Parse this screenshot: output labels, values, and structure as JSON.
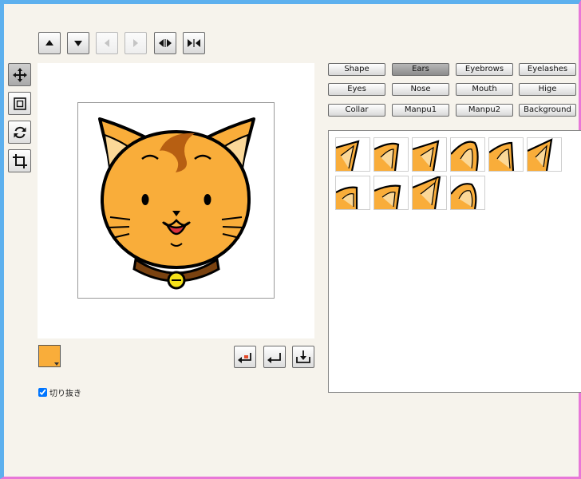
{
  "toolbar": {
    "buttons": [
      {
        "icon": "move-up-icon",
        "state": "enabled"
      },
      {
        "icon": "move-down-icon",
        "state": "enabled"
      },
      {
        "icon": "move-left-icon",
        "state": "disabled"
      },
      {
        "icon": "move-right-icon",
        "state": "disabled"
      },
      {
        "icon": "widen-icon",
        "state": "enabled"
      },
      {
        "icon": "narrow-icon",
        "state": "enabled"
      }
    ]
  },
  "tools": [
    {
      "icon": "move-tool-icon",
      "active": true
    },
    {
      "icon": "scale-tool-icon",
      "active": false
    },
    {
      "icon": "rotate-tool-icon",
      "active": false
    },
    {
      "icon": "crop-tool-icon",
      "active": false
    }
  ],
  "color": {
    "current": "#f9ad3a"
  },
  "actions": [
    {
      "icon": "reset-icon"
    },
    {
      "icon": "undo-icon"
    },
    {
      "icon": "save-icon"
    }
  ],
  "crop": {
    "label": "切り抜き",
    "checked": true
  },
  "categories": [
    {
      "label": "Shape",
      "selected": false
    },
    {
      "label": "Ears",
      "selected": true
    },
    {
      "label": "Eyebrows",
      "selected": false
    },
    {
      "label": "Eyelashes",
      "selected": false
    },
    {
      "label": "Eyes",
      "selected": false
    },
    {
      "label": "Nose",
      "selected": false
    },
    {
      "label": "Mouth",
      "selected": false
    },
    {
      "label": "Hige",
      "selected": false
    },
    {
      "label": "Collar",
      "selected": false
    },
    {
      "label": "Manpu1",
      "selected": false
    },
    {
      "label": "Manpu2",
      "selected": false
    },
    {
      "label": "Background",
      "selected": false
    }
  ],
  "parts": {
    "category": "Ears",
    "items": [
      "ear-1",
      "ear-2",
      "ear-3",
      "ear-4",
      "ear-5",
      "ear-6",
      "ear-7",
      "ear-8",
      "ear-9",
      "ear-10"
    ]
  }
}
